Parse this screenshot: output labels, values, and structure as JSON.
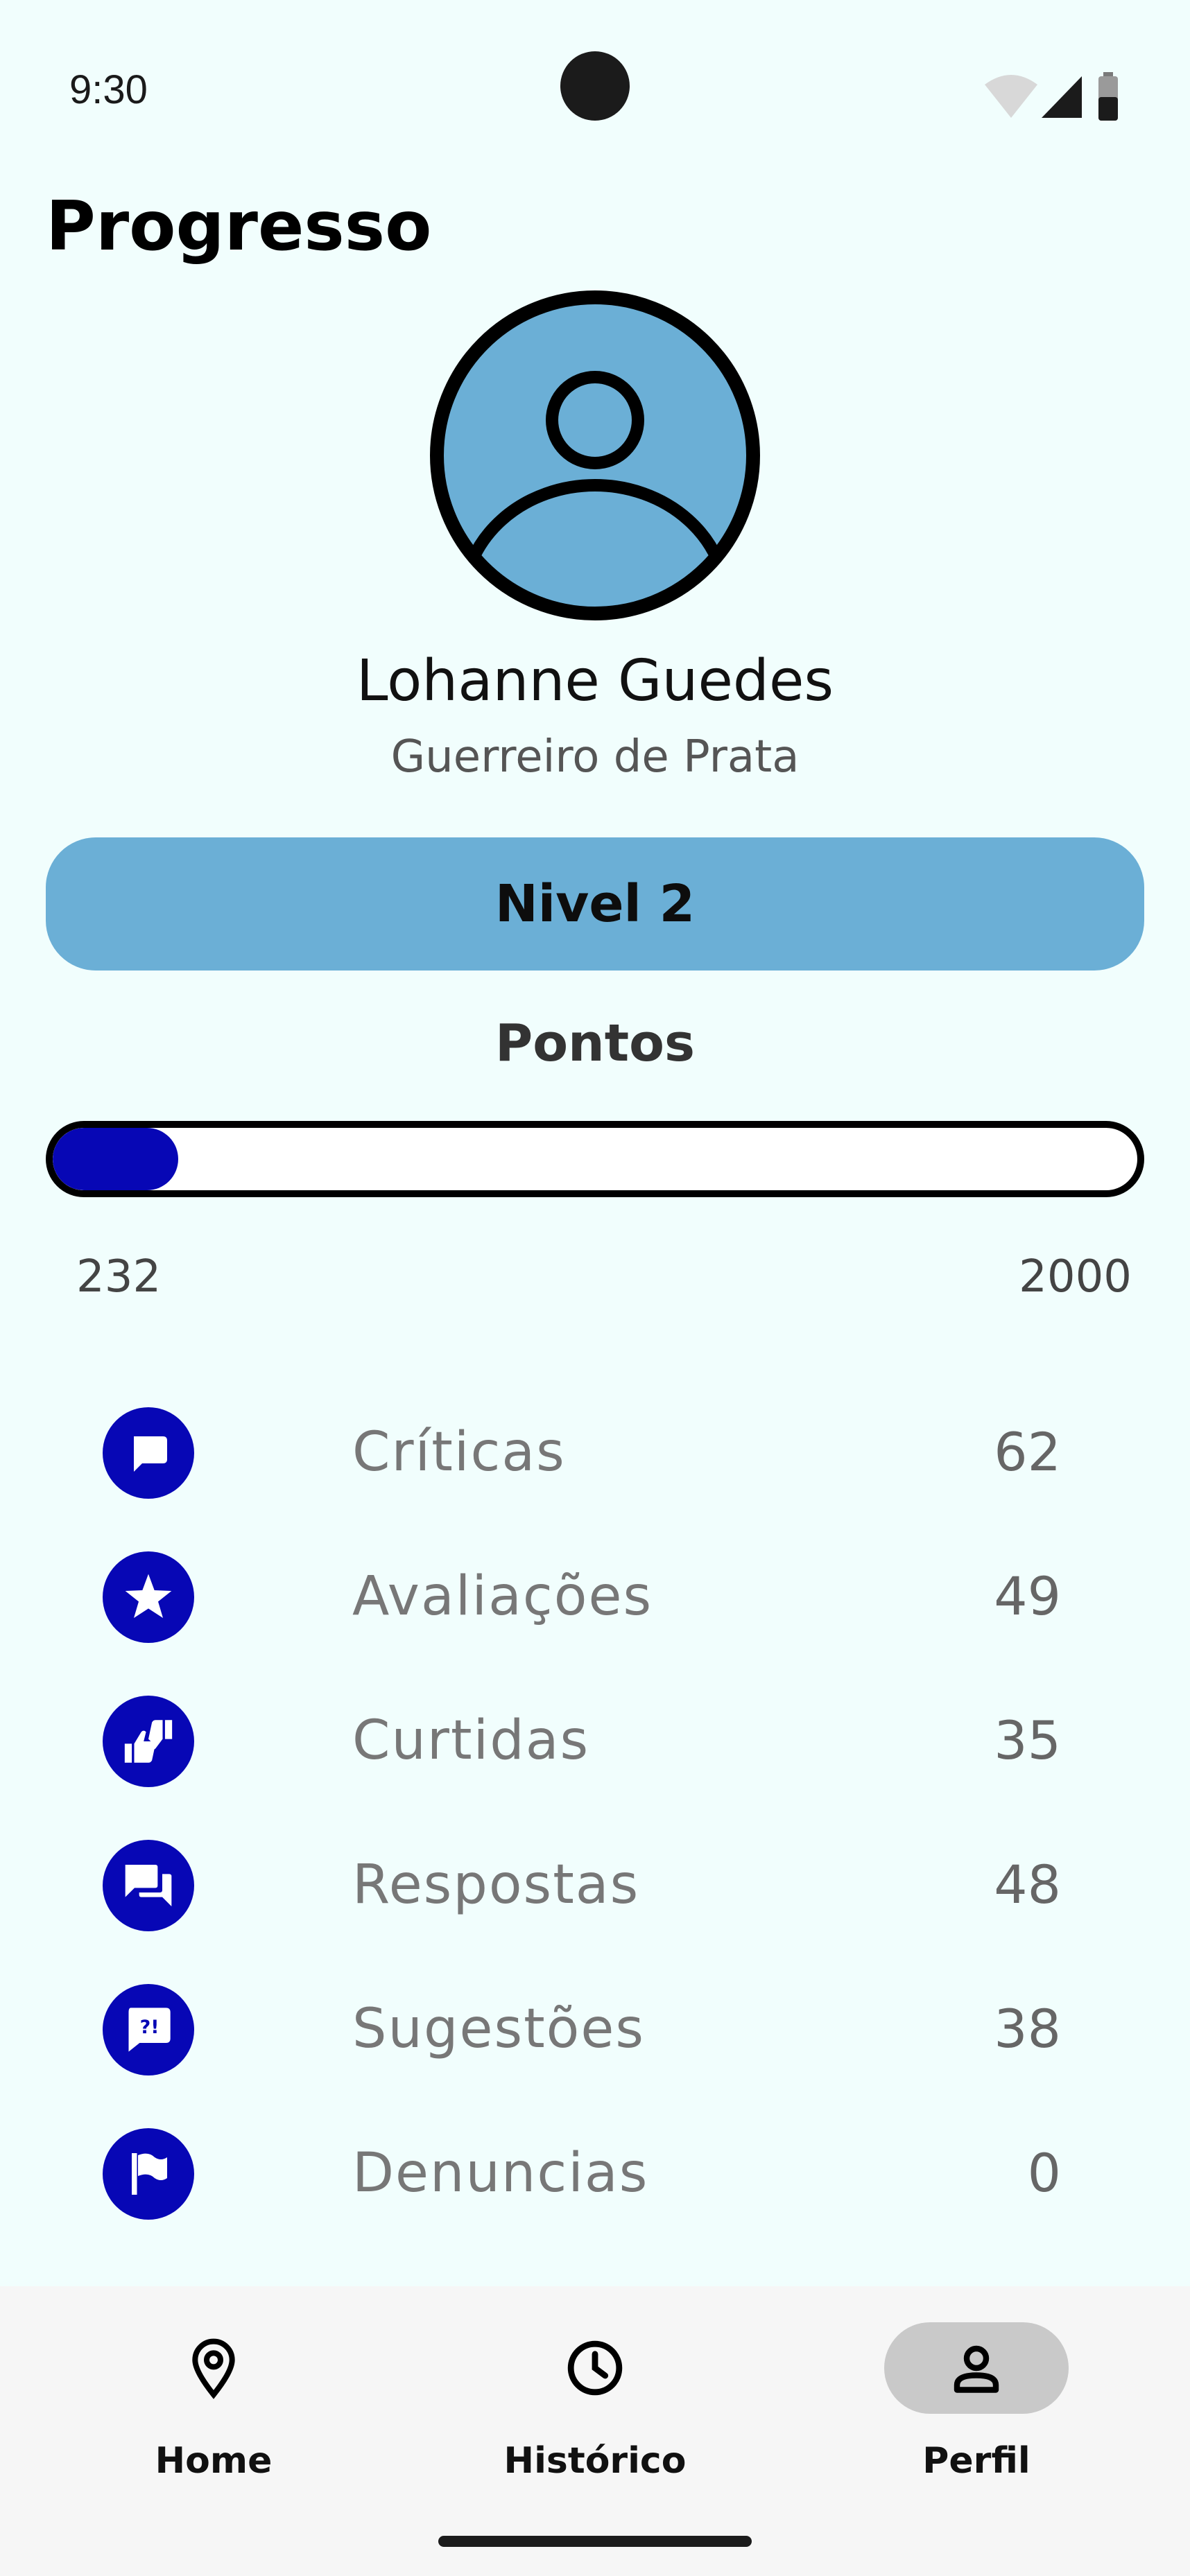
{
  "status_bar": {
    "time": "9:30"
  },
  "header": {
    "title": "Progresso"
  },
  "profile": {
    "name": "Lohanne Guedes",
    "rank": "Guerreiro de Prata",
    "avatar_color": "#6BAFD6"
  },
  "level": {
    "label": "Nivel 2"
  },
  "points": {
    "title": "Pontos",
    "current": "232",
    "max": "2000",
    "progress_fraction": 0.116,
    "bar_color": "#0707B5"
  },
  "stats": [
    {
      "icon": "comment-icon",
      "label": "Críticas",
      "value": "62"
    },
    {
      "icon": "star-icon",
      "label": "Avaliações",
      "value": "49"
    },
    {
      "icon": "thumbs-up-down-icon",
      "label": "Curtidas",
      "value": "35"
    },
    {
      "icon": "chat-bubbles-icon",
      "label": "Respostas",
      "value": "48"
    },
    {
      "icon": "suggestion-icon",
      "label": "Sugestões",
      "value": "38"
    },
    {
      "icon": "flag-icon",
      "label": "Denuncias",
      "value": "0"
    }
  ],
  "bottom_nav": {
    "items": [
      {
        "icon": "location-pin-icon",
        "label": "Home",
        "active": false
      },
      {
        "icon": "clock-icon",
        "label": "Histórico",
        "active": false
      },
      {
        "icon": "person-icon",
        "label": "Perfil",
        "active": true
      }
    ]
  },
  "colors": {
    "background": "#F1FEFD",
    "accent": "#0707B5",
    "level_pill": "#6BAFD6"
  }
}
